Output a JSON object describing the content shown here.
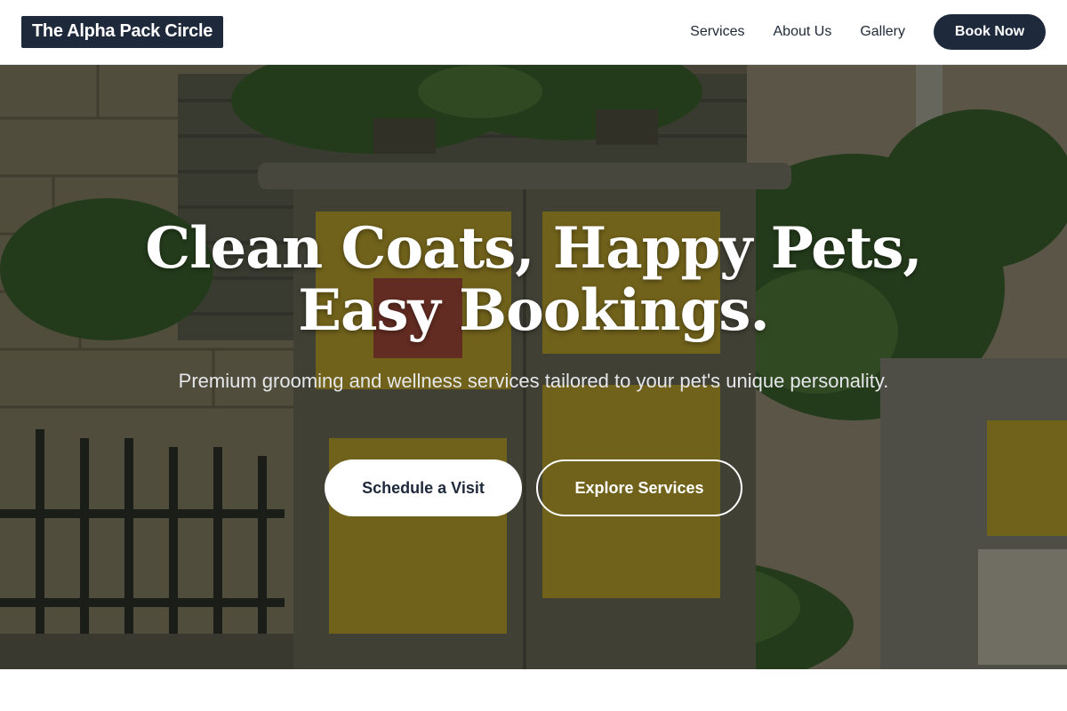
{
  "header": {
    "logo": "The Alpha Pack Circle",
    "nav": [
      {
        "label": "Services"
      },
      {
        "label": "About Us"
      },
      {
        "label": "Gallery"
      }
    ],
    "cta_label": "Book Now"
  },
  "hero": {
    "title_line1": "Clean Coats, Happy Pets,",
    "title_line2": "Easy Bookings.",
    "subtitle": "Premium grooming and wellness services tailored to your pet's unique personality.",
    "primary_button": "Schedule a Visit",
    "secondary_button": "Explore Services",
    "background": "photo of street utility box covered in yellow posters with green plants"
  },
  "colors": {
    "brand_dark": "#1e293b",
    "white": "#ffffff",
    "poster_yellow": "#e8c02a",
    "foliage_green": "#3f6b2a"
  }
}
